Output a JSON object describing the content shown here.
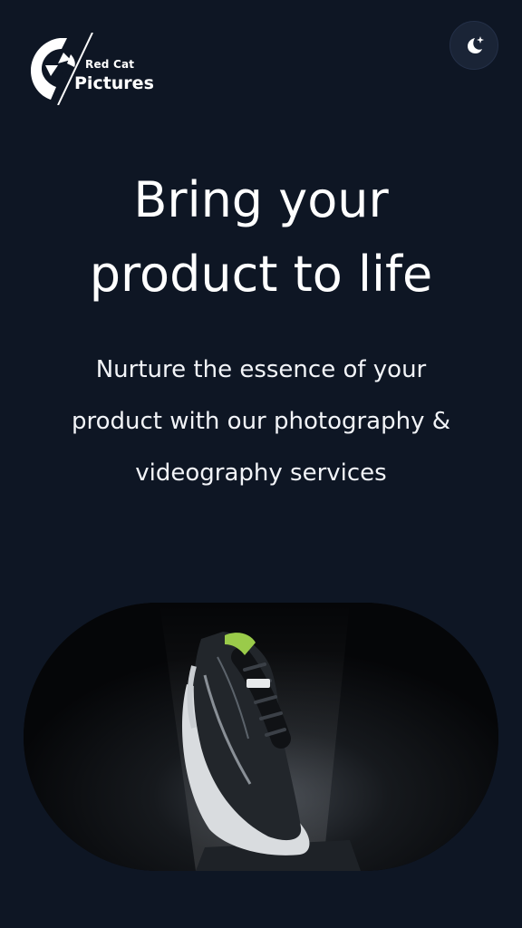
{
  "brand": {
    "line1": "Red Cat",
    "line2": "Pictures",
    "logo_icon": "camera-shutter-cat-icon"
  },
  "header": {
    "theme_toggle_icon": "moon-stars-icon"
  },
  "hero": {
    "title_line1": "Bring your",
    "title_line2": "product to life",
    "subtitle_line1": "Nurture the essence of your",
    "subtitle_line2": "product with our photography &",
    "subtitle_line3": "videography services",
    "image_subject": "sneaker-product-photo"
  },
  "colors": {
    "background": "#0e1624",
    "text": "#ffffff",
    "button_bg": "#1a2436"
  }
}
